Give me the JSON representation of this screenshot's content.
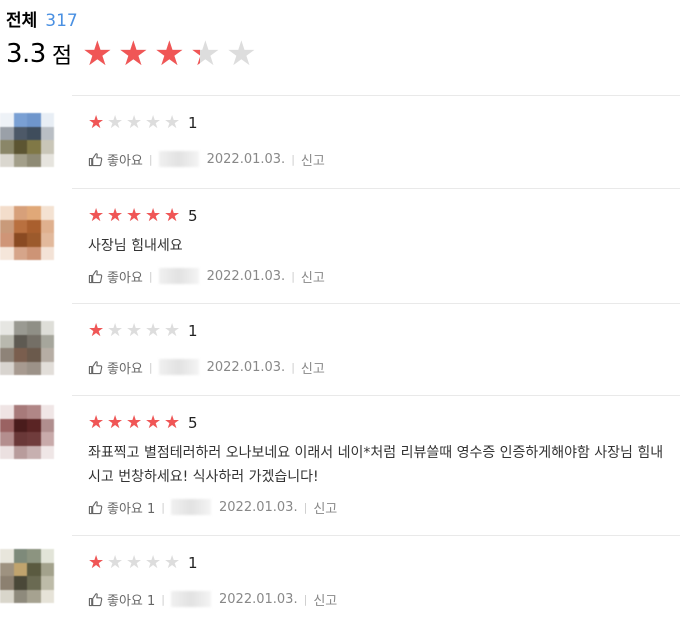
{
  "summary": {
    "total_label": "전체",
    "total_count": "317",
    "average": "3.3",
    "average_unit": "점",
    "average_fill": 0.66
  },
  "colors": {
    "star_on": "#f05656",
    "star_off": "#dddddd",
    "count_blue": "#4a90e2"
  },
  "icons": {
    "like": "thumbs-up-icon",
    "star": "star-icon"
  },
  "reviews": [
    {
      "rating": 1,
      "rating_text": "1",
      "text": "",
      "like_label": "좋아요",
      "date": "2022.01.03.",
      "report_label": "신고",
      "avatar_colors": [
        "#eef2f7",
        "#7aa0d4",
        "#6f96cc",
        "#e8eef5",
        "#9aa0a8",
        "#4d5968",
        "#3f4d5c",
        "#b9bec4",
        "#8a8668",
        "#5c5532",
        "#807846",
        "#c9c6b8",
        "#dad7cf",
        "#a39f8a",
        "#8e8a74",
        "#e6e4de"
      ]
    },
    {
      "rating": 5,
      "rating_text": "5",
      "text": "사장님 힘내세요",
      "like_label": "좋아요",
      "date": "2022.01.03.",
      "report_label": "신고",
      "avatar_colors": [
        "#f3ddcb",
        "#d7a07a",
        "#e0a878",
        "#f4e2d2",
        "#c99a7a",
        "#b9703f",
        "#a95f2e",
        "#dfb08e",
        "#cf9577",
        "#8a4a22",
        "#9c5a2c",
        "#e2b99c",
        "#f5e6da",
        "#d6a58a",
        "#cd9476",
        "#f3e2d6"
      ]
    },
    {
      "rating": 1,
      "rating_text": "1",
      "text": "",
      "like_label": "좋아요",
      "date": "2022.01.03.",
      "report_label": "신고",
      "avatar_colors": [
        "#e6e6e2",
        "#9a9a92",
        "#8f8f86",
        "#deded8",
        "#b8b8ae",
        "#5e5a52",
        "#746f66",
        "#a6a69c",
        "#8e8378",
        "#7a5e4e",
        "#6b5a4c",
        "#b6ada4",
        "#d8d4cf",
        "#a79a90",
        "#9c9288",
        "#e2ded9"
      ]
    },
    {
      "rating": 5,
      "rating_text": "5",
      "text": "좌표찍고 별점테러하러 오나보네요 이래서 네이*처럼 리뷰쓸때 영수증 인증하게해야함 사장님 힘내시고 번창하세요! 식사하러 가겠습니다!",
      "like_label": "좋아요 1",
      "date": "2022.01.03.",
      "report_label": "신고",
      "avatar_colors": [
        "#efe4e4",
        "#a77a7a",
        "#b08686",
        "#f0e6e6",
        "#9a6262",
        "#4a1c1c",
        "#5a2424",
        "#b08e8e",
        "#b48e8e",
        "#6a3838",
        "#703c3c",
        "#c8aaaa",
        "#ebe0e0",
        "#b89c9c",
        "#c7b0b0",
        "#efe6e6"
      ]
    },
    {
      "rating": 1,
      "rating_text": "1",
      "text": "",
      "like_label": "좋아요 1",
      "date": "2022.01.03.",
      "report_label": "신고",
      "avatar_colors": [
        "#e8e6dc",
        "#7e8a7a",
        "#8c9480",
        "#e2e4d8",
        "#9e9280",
        "#c0a46e",
        "#5a5a40",
        "#a3a28c",
        "#8c8070",
        "#4a4838",
        "#6a6a52",
        "#bdbba8",
        "#d9d6cb",
        "#8e8a7c",
        "#a6a290",
        "#e6e3d8"
      ]
    }
  ]
}
